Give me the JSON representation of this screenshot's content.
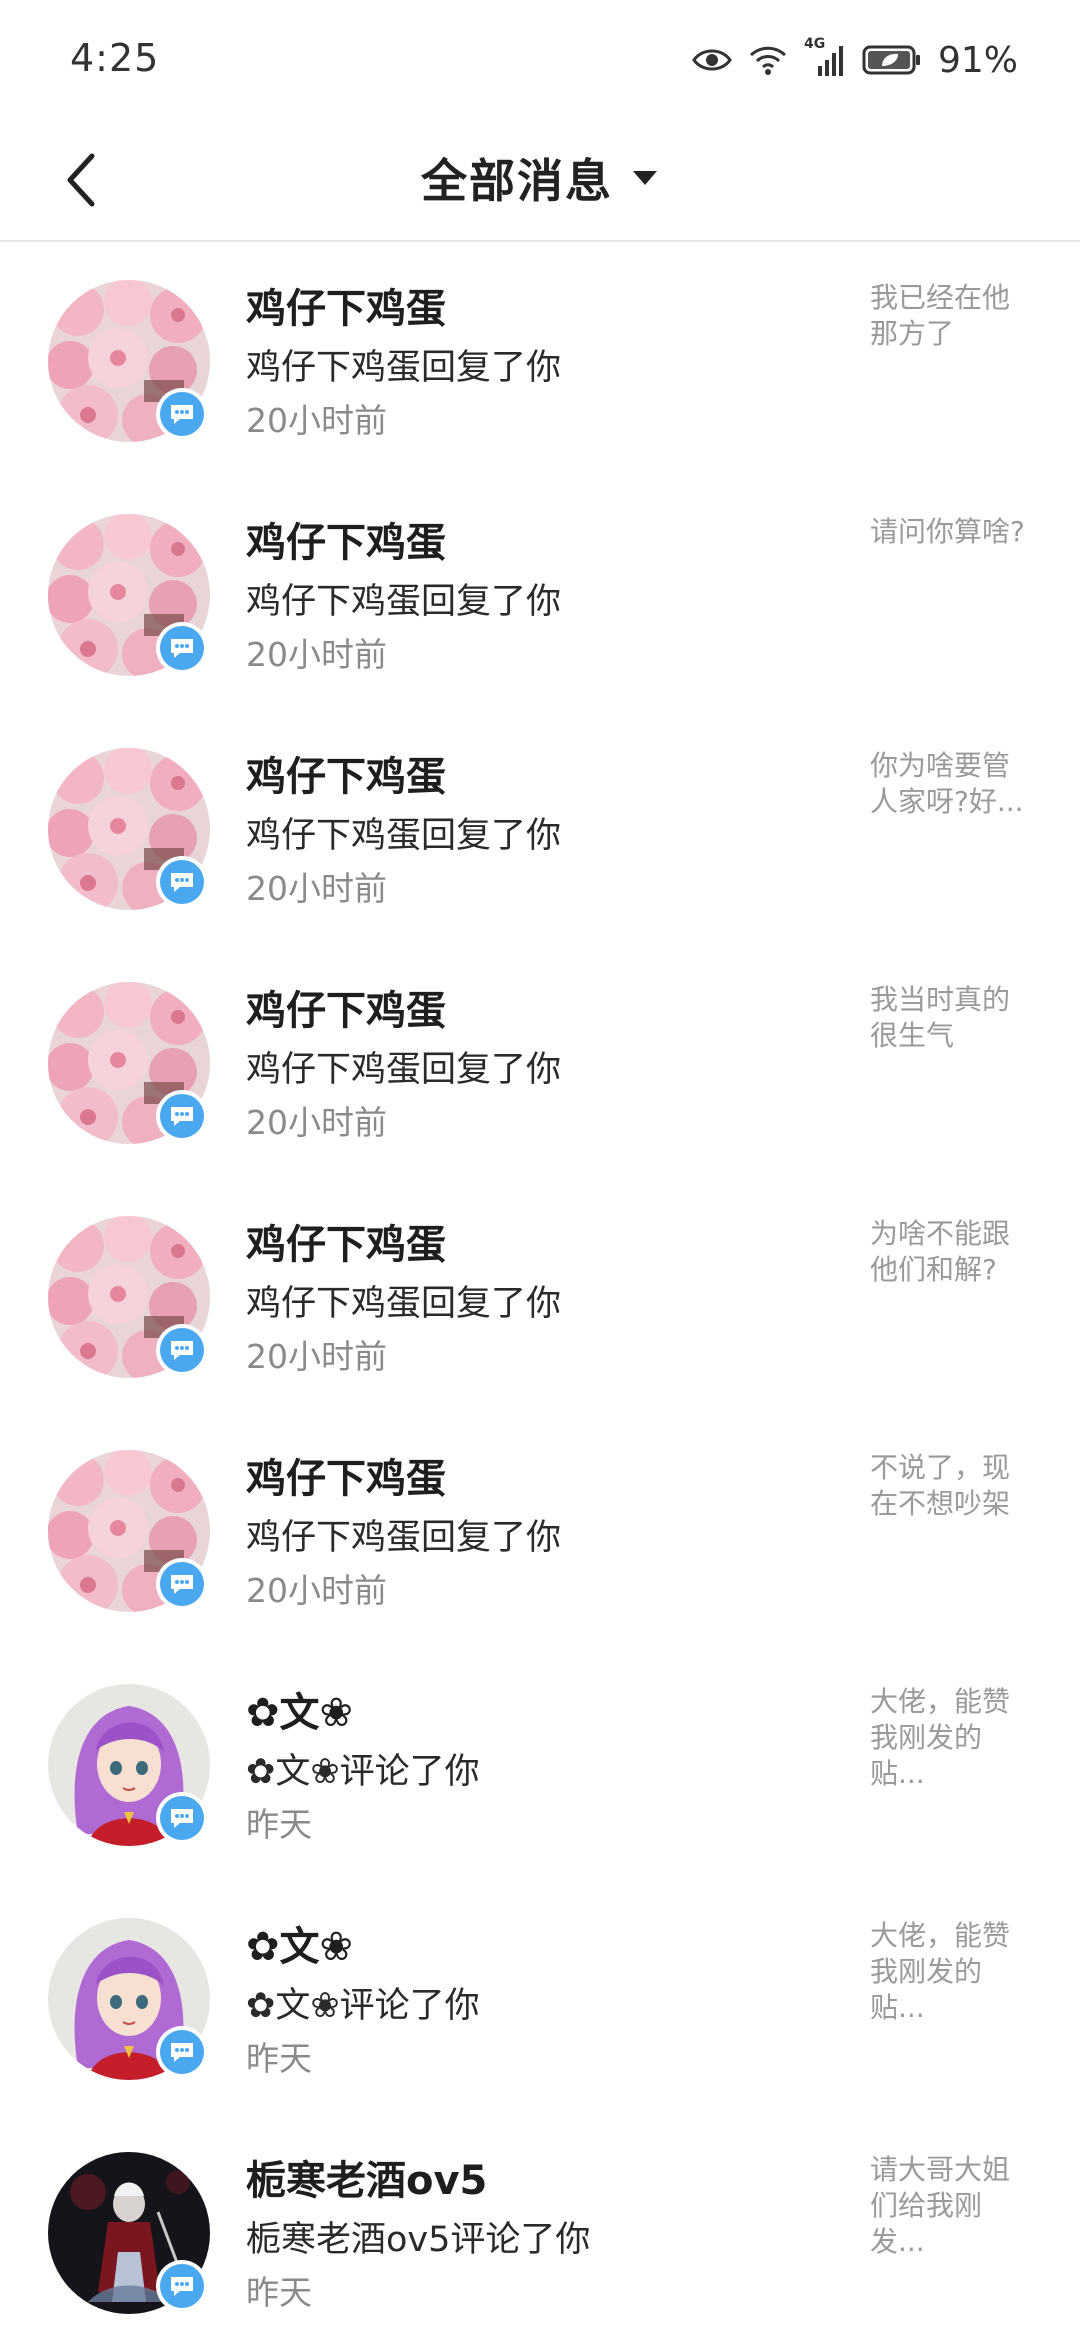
{
  "status_bar": {
    "time": "4:25",
    "network": "4G",
    "battery": "91%"
  },
  "header": {
    "title": "全部消息"
  },
  "messages": [
    {
      "name": "鸡仔下鸡蛋",
      "action": "鸡仔下鸡蛋回复了你",
      "time": "20小时前",
      "preview": "我已经在他那方了",
      "avatar": "pink-flowers"
    },
    {
      "name": "鸡仔下鸡蛋",
      "action": "鸡仔下鸡蛋回复了你",
      "time": "20小时前",
      "preview": "请问你算啥?",
      "avatar": "pink-flowers"
    },
    {
      "name": "鸡仔下鸡蛋",
      "action": "鸡仔下鸡蛋回复了你",
      "time": "20小时前",
      "preview": "你为啥要管人家呀?好...",
      "avatar": "pink-flowers"
    },
    {
      "name": "鸡仔下鸡蛋",
      "action": "鸡仔下鸡蛋回复了你",
      "time": "20小时前",
      "preview": "我当时真的很生气",
      "avatar": "pink-flowers"
    },
    {
      "name": "鸡仔下鸡蛋",
      "action": "鸡仔下鸡蛋回复了你",
      "time": "20小时前",
      "preview": "为啥不能跟他们和解?",
      "avatar": "pink-flowers"
    },
    {
      "name": "鸡仔下鸡蛋",
      "action": "鸡仔下鸡蛋回复了你",
      "time": "20小时前",
      "preview": "不说了，现在不想吵架",
      "avatar": "pink-flowers"
    },
    {
      "name": "✿文❀",
      "action": "✿文❀评论了你",
      "time": "昨天",
      "preview": "大佬，能赞我刚发的贴...",
      "avatar": "anime-girl"
    },
    {
      "name": "✿文❀",
      "action": "✿文❀评论了你",
      "time": "昨天",
      "preview": "大佬，能赞我刚发的贴...",
      "avatar": "anime-girl"
    },
    {
      "name": "栀寒老酒ov5",
      "action": "栀寒老酒ov5评论了你",
      "time": "昨天",
      "preview": "请大哥大姐们给我刚发...",
      "avatar": "dark-character"
    }
  ],
  "icons": {
    "back": "chevron-left-icon",
    "dropdown": "caret-down-icon",
    "badge": "chat-bubble-icon",
    "eye": "eye-icon",
    "wifi": "wifi-icon",
    "signal": "signal-icon",
    "battery": "battery-icon"
  },
  "colors": {
    "badge": "#4aa8f0",
    "time_text": "#8a8a8a",
    "preview_text": "#9a9a9a",
    "divider": "#e6e6e6"
  }
}
